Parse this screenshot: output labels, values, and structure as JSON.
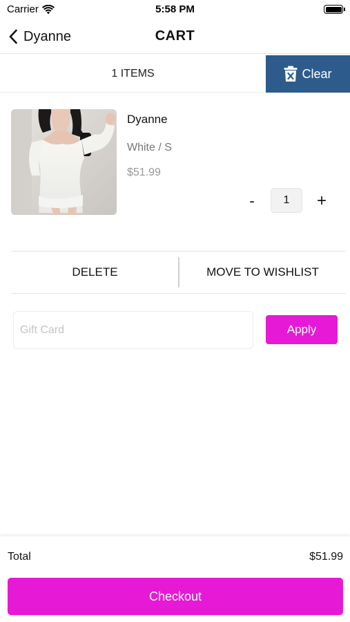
{
  "status_bar": {
    "carrier": "Carrier",
    "time": "5:58 PM",
    "icons": [
      "wifi-icon",
      "battery-icon"
    ]
  },
  "nav": {
    "back_label": "Dyanne",
    "back_icon": "chevron-left-icon",
    "title": "CART"
  },
  "cart_header": {
    "items_count": "1 ITEMS",
    "clear_label": "Clear",
    "clear_icon": "trash-x-icon",
    "clear_color": "#2d5b8c"
  },
  "items": [
    {
      "name": "Dyanne",
      "variant": "White / S",
      "price": "$51.99",
      "quantity": "1",
      "minus": "-",
      "plus": "+"
    }
  ],
  "actions": {
    "delete_label": "DELETE",
    "wishlist_label": "MOVE TO WISHLIST"
  },
  "gift_card": {
    "placeholder": "Gift Card",
    "value": "",
    "apply_label": "Apply"
  },
  "footer": {
    "total_label": "Total",
    "total_value": "$51.99",
    "checkout_label": "Checkout"
  },
  "colors": {
    "accent": "#e619d6",
    "clear_button": "#2d5b8c"
  }
}
